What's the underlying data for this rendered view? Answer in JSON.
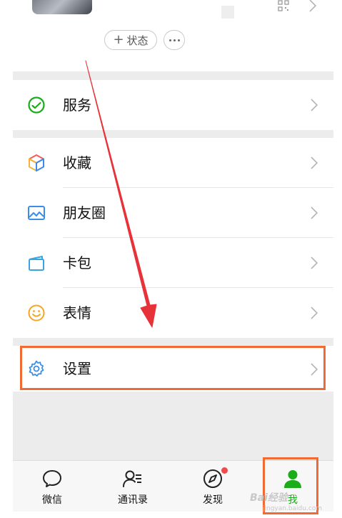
{
  "profile": {
    "status_label": "状态",
    "status_plus": "+"
  },
  "menu": {
    "service": "服务",
    "favorites": "收藏",
    "moments": "朋友圈",
    "cards": "卡包",
    "stickers": "表情",
    "settings": "设置"
  },
  "tabbar": {
    "chats": "微信",
    "contacts": "通讯录",
    "discover": "发现",
    "me": "我"
  },
  "watermark": {
    "brand": "Bai经验",
    "url": "jingyan.baidu.com"
  },
  "colors": {
    "accent_green": "#1aad19",
    "highlight_orange": "#f06b34",
    "arrow_red": "#e8323a",
    "notification_dot": "#f24a4a"
  }
}
